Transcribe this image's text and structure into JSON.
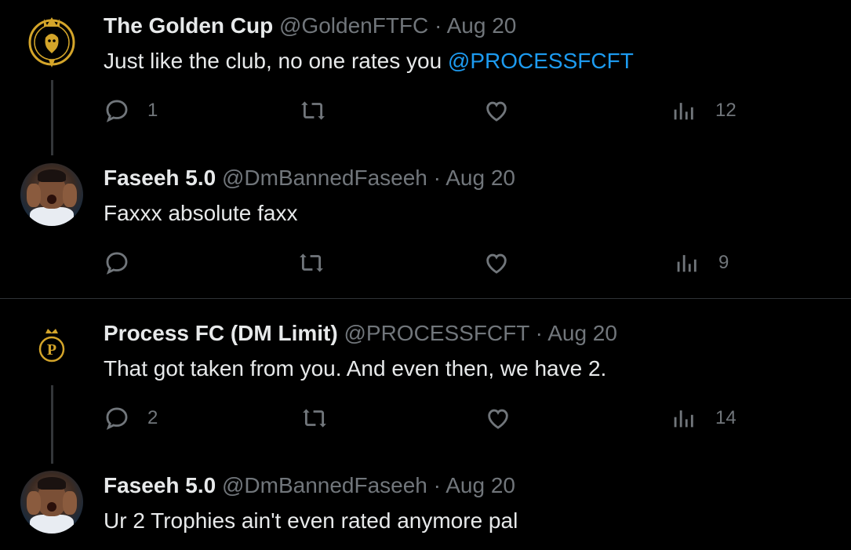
{
  "tweets": [
    {
      "name": "The Golden Cup",
      "handle": "@GoldenFTFC",
      "dot": "·",
      "date": "Aug 20",
      "text": "Just like the club, no one rates you ",
      "mention": "@PROCESSFCFT",
      "replies": "1",
      "retweets": "",
      "likes": "",
      "views": "12",
      "avatar": "golden-cup-logo"
    },
    {
      "name": "Faseeh 5.0",
      "handle": "@DmBannedFaseeh",
      "dot": "·",
      "date": "Aug 20",
      "text": "Faxxx absolute faxx",
      "replies": "",
      "retweets": "",
      "likes": "",
      "views": "9",
      "avatar": "faseeh-photo"
    },
    {
      "name": "Process FC (DM Limit)",
      "handle": "@PROCESSFCFT",
      "dot": "·",
      "date": "Aug 20",
      "text": "That got taken from you. And even then, we have 2.",
      "replies": "2",
      "retweets": "",
      "likes": "",
      "views": "14",
      "avatar": "process-fc-logo"
    },
    {
      "name": "Faseeh 5.0",
      "handle": "@DmBannedFaseeh",
      "dot": "·",
      "date": "Aug 20",
      "text": "Ur 2 Trophies ain't even rated anymore pal",
      "avatar": "faseeh-photo"
    }
  ],
  "colors": {
    "background": "#000000",
    "text": "#e7e9ea",
    "secondary": "#71767b",
    "link": "#1d9bf0",
    "gold": "#d4a52a"
  }
}
